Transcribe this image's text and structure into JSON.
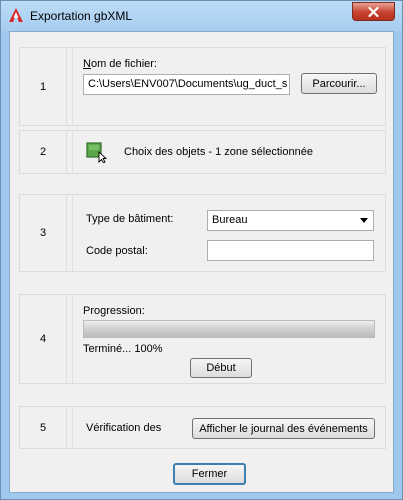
{
  "window": {
    "title": "Exportation gbXML"
  },
  "section1": {
    "number": "1",
    "filename_label": "Nom de fichier:",
    "filename_value": "C:\\Users\\ENV007\\Documents\\ug_duct_s",
    "browse_button": "Parcourir..."
  },
  "section2": {
    "number": "2",
    "selection_text": "Choix des objets - 1 zone sélectionnée"
  },
  "section3": {
    "number": "3",
    "building_type_label": "Type de bâtiment:",
    "building_type_value": "Bureau",
    "postal_code_label": "Code postal:",
    "postal_code_value": ""
  },
  "section4": {
    "number": "4",
    "progress_label": "Progression:",
    "progress_percent": 100,
    "status_text": "Terminé... 100%",
    "start_button": "Début"
  },
  "section5": {
    "number": "5",
    "verification_label": "Vérification des",
    "log_button": "Afficher le journal des événements"
  },
  "footer": {
    "close_button": "Fermer"
  },
  "icons": {
    "app": "autocad-a-icon",
    "window_close": "close-icon",
    "select_objects": "select-objects-icon",
    "dropdown": "chevron-down-icon"
  },
  "colors": {
    "title_bar": "#a6cdf0",
    "close_button": "#c7412e",
    "dialog_bg": "#f0f0f0"
  }
}
